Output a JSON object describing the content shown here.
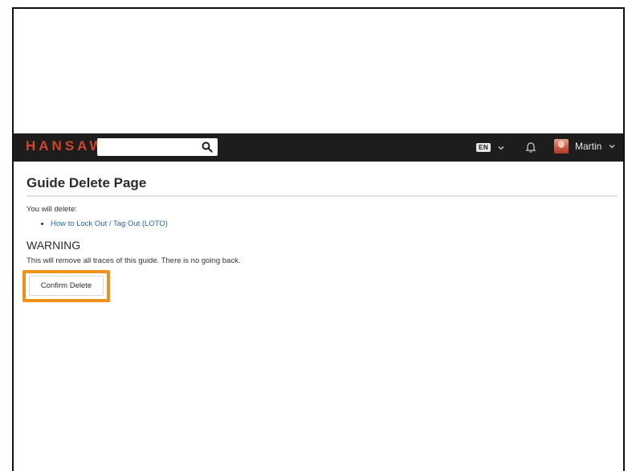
{
  "header": {
    "logo": "HANSAW",
    "search": {
      "placeholder": "",
      "value": ""
    },
    "language_badge": "EN",
    "user_name": "Martin"
  },
  "main": {
    "title": "Guide Delete Page",
    "intro": "You will delete:",
    "guides": [
      "How to Lock Out / Tag Out (LOTO)"
    ],
    "warning_heading": "WARNING",
    "warning_text": "This will remove all traces of this guide. There is no going back.",
    "confirm_label": "Confirm Delete"
  },
  "colors": {
    "topbar": "#1d1d1d",
    "logo": "#d2452a",
    "link": "#2566ad",
    "highlight": "#f0921a"
  }
}
